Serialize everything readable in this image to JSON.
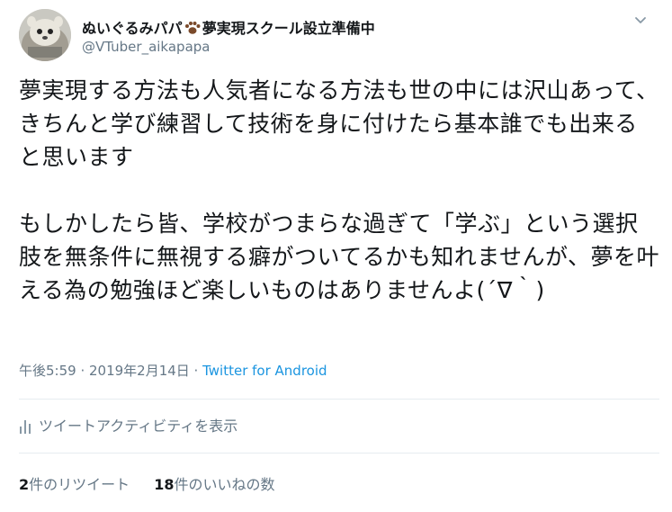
{
  "user": {
    "display_name": "ぬいぐるみパパ",
    "display_name_suffix": "夢実現スクール設立準備中",
    "handle": "@VTuber_aikapapa"
  },
  "tweet": {
    "paragraph1": "夢実現する方法も人気者になる方法も世の中には沢山あって、きちんと学び練習して技術を身に付けたら基本誰でも出来ると思います",
    "paragraph2": "もしかしたら皆、学校がつまらな過ぎて「学ぶ」という選択肢を無条件に無視する癖がついてるかも知れませんが、夢を叶える為の勉強ほど楽しいものはありませんよ(´∇｀)"
  },
  "meta": {
    "timestamp": "午後5:59 · 2019年2月14日 · ",
    "source": "Twitter for Android"
  },
  "activity": {
    "label": "ツイートアクティビティを表示"
  },
  "stats": {
    "retweets_count": "2",
    "retweets_label": "件のリツイート",
    "likes_count": "18",
    "likes_label": "件のいいねの数"
  },
  "colors": {
    "text": "#14171a",
    "secondary": "#657786",
    "link": "#1b95e0",
    "divider": "#e6ecf0"
  },
  "icons": [
    "avatar",
    "paw-icon",
    "chevron-down-icon",
    "activity-bar-chart-icon"
  ]
}
